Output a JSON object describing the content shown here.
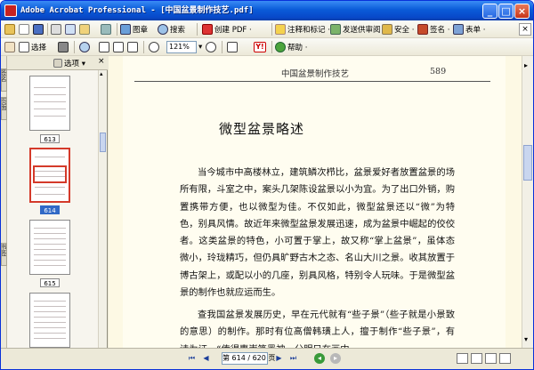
{
  "window": {
    "title": "Adobe Acrobat Professional - [中国盆景制作技艺.pdf]"
  },
  "toolbar1": {
    "items": [
      {
        "icon": "open-folder-icon",
        "label": ""
      },
      {
        "icon": "save-icon",
        "label": ""
      },
      {
        "icon": "print-icon",
        "label": ""
      },
      {
        "icon": "email-icon",
        "label": ""
      },
      {
        "icon": "picture-icon",
        "label": "图章"
      },
      {
        "icon": "search-icon",
        "label": "搜索"
      },
      {
        "icon": "create-pdf-icon",
        "label": "创建 PDF ·"
      },
      {
        "icon": "comment-icon",
        "label": "注释和标记 ·"
      },
      {
        "icon": "review-icon",
        "label": "发送供审阅 ·"
      },
      {
        "icon": "lock-icon",
        "label": "安全 ·"
      },
      {
        "icon": "sign-icon",
        "label": "签名 ·"
      },
      {
        "icon": "form-icon",
        "label": "表单 ·"
      }
    ]
  },
  "toolbar2": {
    "select_label": "选择",
    "zoom_value": "121%",
    "help_label": "帮助 ·"
  },
  "left_panel": {
    "options_label": "选项",
    "tabs": [
      "签名",
      "页面",
      "书签"
    ],
    "thumbnails": [
      {
        "label": "613",
        "selected": false
      },
      {
        "label": "614",
        "selected": true
      },
      {
        "label": "615",
        "selected": false
      },
      {
        "label": "",
        "selected": false
      }
    ]
  },
  "document": {
    "header_title": "中国盆景制作技艺",
    "page_number": "589",
    "title": "微型盆景略述",
    "paragraphs": [
      "当今城市中高楼林立，建筑鳞次栉比，盆景爱好者放置盆景的场所有限，斗室之中，案头几架陈设盆景以小为宜。为了出口外销，购置携带方便，也以微型为佳。不仅如此，微型盆景还以“微”为特色，别具风情。故近年来微型盆景发展迅速，成为盆景中崛起的佼佼者。这类盆景的特色，小可置于掌上，故又称“掌上盆景”，虽体态微小，玲珑精巧，但仍具旷野古木之态、名山大川之景。收其放置于博古架上，或配以小的几座，别具风格，特别令人玩味。于是微型盆景的制作也就应运而生。",
      "查我国盆景发展历史，早在元代就有“些子景”（些子就是小景致的意思）的制作。那时有位高僧韩璜上人，擅于制作“些子景”，有诗为证，“传得惠崇笔墨神，分明只在画中"
    ]
  },
  "statusbar": {
    "page_field": "第 614 / 620 页"
  }
}
